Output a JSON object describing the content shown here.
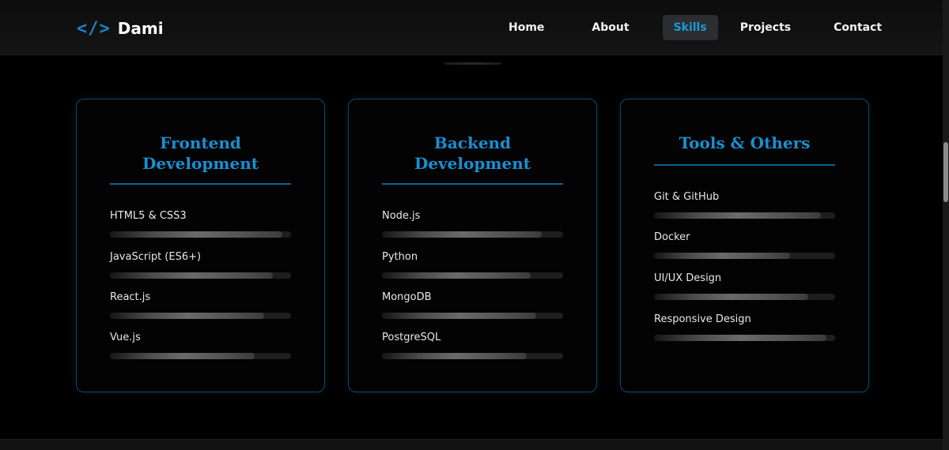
{
  "brand": {
    "icon": "</>",
    "icon_name": "code-brackets-icon",
    "name": "Dami"
  },
  "nav": {
    "items": [
      {
        "label": "Home"
      },
      {
        "label": "About"
      },
      {
        "label": "Skills",
        "active": true
      },
      {
        "label": "Projects"
      },
      {
        "label": "Contact"
      }
    ]
  },
  "colors": {
    "accent": "#1a8fd0",
    "background": "#000000",
    "card_border": "#0f4a6e"
  },
  "cards": [
    {
      "title_lines": [
        "Frontend",
        "Development"
      ],
      "skills": [
        {
          "name": "HTML5 & CSS3",
          "level": 0.95
        },
        {
          "name": "JavaScript (ES6+)",
          "level": 0.9
        },
        {
          "name": "React.js",
          "level": 0.85
        },
        {
          "name": "Vue.js",
          "level": 0.8
        }
      ]
    },
    {
      "title_lines": [
        "Backend",
        "Development"
      ],
      "skills": [
        {
          "name": "Node.js",
          "level": 0.88
        },
        {
          "name": "Python",
          "level": 0.82
        },
        {
          "name": "MongoDB",
          "level": 0.85
        },
        {
          "name": "PostgreSQL",
          "level": 0.8
        }
      ]
    },
    {
      "title_lines": [
        "Tools & Others"
      ],
      "skills": [
        {
          "name": "Git & GitHub",
          "level": 0.92
        },
        {
          "name": "Docker",
          "level": 0.75
        },
        {
          "name": "UI/UX Design",
          "level": 0.85
        },
        {
          "name": "Responsive Design",
          "level": 0.95
        }
      ]
    }
  ]
}
